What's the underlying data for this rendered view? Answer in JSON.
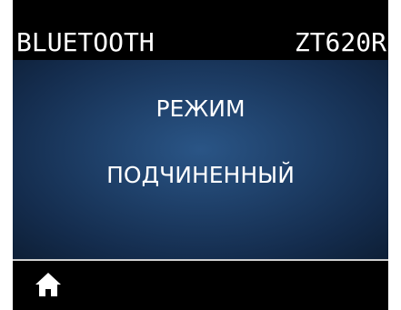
{
  "header": {
    "title": "BLUETOOTH",
    "model": "ZT620R"
  },
  "setting": {
    "name": "РЕЖИМ",
    "value": "ПОДЧИНЕННЫЙ"
  },
  "footer": {
    "home_icon": "home-icon"
  },
  "colors": {
    "background": "#000000",
    "content_center": "#2a5586",
    "content_edge": "#0e2038",
    "text": "#ffffff",
    "divider": "#cfcfcf"
  }
}
